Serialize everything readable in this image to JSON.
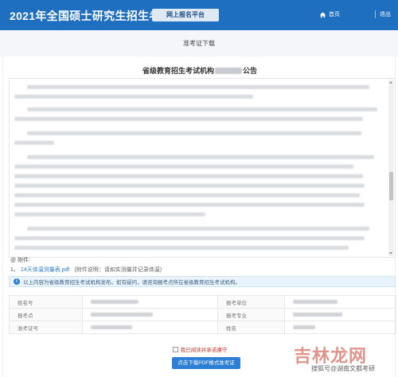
{
  "header": {
    "title": "2021年全国硕士研究生招生考试",
    "platform_badge": "网上报名平台",
    "nav_home": "首页",
    "nav_more": "退出"
  },
  "page": {
    "title": "准考证下载"
  },
  "notice": {
    "title_prefix": "省级教育招生考试机构",
    "title_suffix": "公告"
  },
  "attachments": {
    "label": "附件:",
    "items": [
      {
        "index": "1、",
        "file": "14天体温测量表.pdf",
        "note": "(附件说明：请如实测量并记录体温)"
      }
    ]
  },
  "info_alert": {
    "text": "以上内容为省级教育招生考试机构发布。如有疑问，请咨询报考点所在省级教育招生考试机构。"
  },
  "info_table": {
    "rows": [
      {
        "l1": "姓名号",
        "l2": "报考单位"
      },
      {
        "l1": "报考点",
        "l2": "报考专业"
      },
      {
        "l1": "准考证号",
        "l2": "姓名"
      }
    ]
  },
  "agree": {
    "label": "我已阅读并承诺遵守"
  },
  "download_button": {
    "label": "点击下载PDF格式准考证"
  },
  "watermark": {
    "big": "吉林龙网",
    "small": "搜狐号@湖南文都考研"
  },
  "colors": {
    "header_bg": "#1e6fc0",
    "link": "#2f7fd3",
    "button": "#2d7fd6",
    "warning_text": "#c0392b"
  }
}
